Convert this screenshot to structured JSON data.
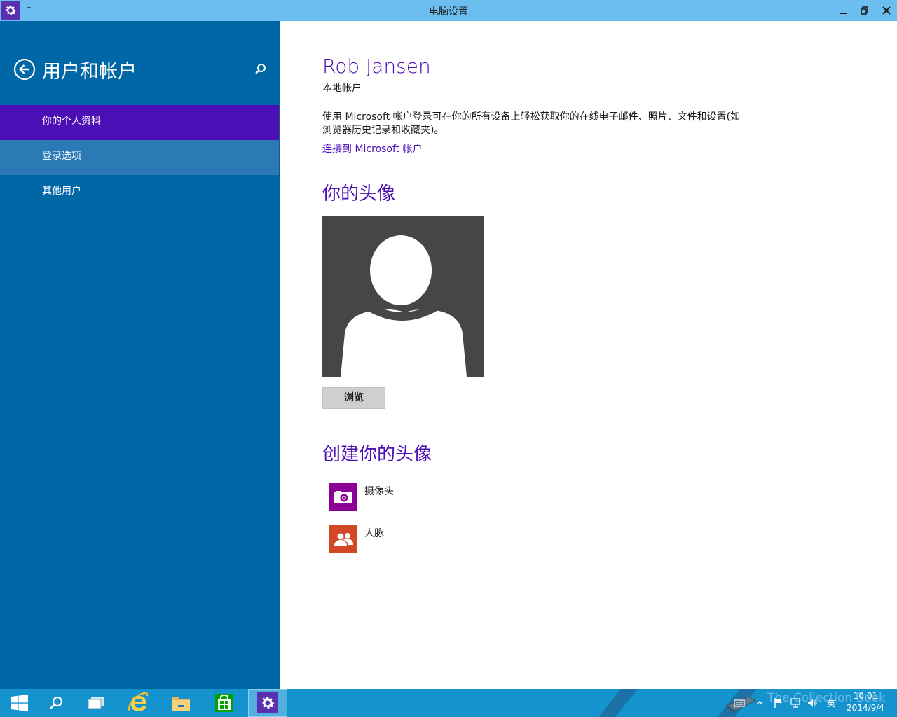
{
  "window": {
    "title": "电脑设置",
    "menu_glyph": "···",
    "app_icon": "gear-icon",
    "controls": [
      "minimize-icon",
      "maximize-icon",
      "close-icon"
    ]
  },
  "sidebar": {
    "title": "用户和帐户",
    "back_icon": "back-arrow-icon",
    "search_icon": "search-icon",
    "items": [
      {
        "label": "你的个人资料",
        "state": "selected"
      },
      {
        "label": "登录选项",
        "state": "hover"
      },
      {
        "label": "其他用户",
        "state": "normal"
      }
    ]
  },
  "main": {
    "user_name": "Rob Jansen",
    "account_type": "本地帐户",
    "description": "使用 Microsoft 帐户登录可在你的所有设备上轻松获取你的在线电子邮件、照片、文件和设置(如浏览器历史记录和收藏夹)。",
    "connect_link": "连接到 Microsoft 帐户",
    "avatar_section_title": "你的头像",
    "avatar_icon": "default-user-avatar",
    "browse_button": "浏览",
    "create_section_title": "创建你的头像",
    "apps": [
      {
        "label": "摄像头",
        "icon": "camera-icon",
        "color": "#8c0095"
      },
      {
        "label": "人脉",
        "icon": "people-icon",
        "color": "#d24726"
      }
    ]
  },
  "taskbar": {
    "items": [
      {
        "name": "start",
        "icon": "windows-logo-icon"
      },
      {
        "name": "search",
        "icon": "search-icon"
      },
      {
        "name": "task-view",
        "icon": "task-view-icon"
      },
      {
        "name": "internet-explorer",
        "icon": "ie-icon"
      },
      {
        "name": "file-explorer",
        "icon": "folder-icon"
      },
      {
        "name": "store",
        "icon": "store-icon"
      },
      {
        "name": "pc-settings",
        "icon": "gear-icon",
        "active": true
      }
    ],
    "tray": {
      "language": "英",
      "time": "10:01",
      "date": "2014/9/4"
    },
    "watermark": "The Collection Book"
  },
  "colors": {
    "titlebar": "#6dbef0",
    "sidebar": "#0067a6",
    "accent": "#4b0fb5",
    "nav_hover": "#2b7ab6",
    "taskbar": "#1593cf",
    "avatar_bg": "#464646"
  }
}
